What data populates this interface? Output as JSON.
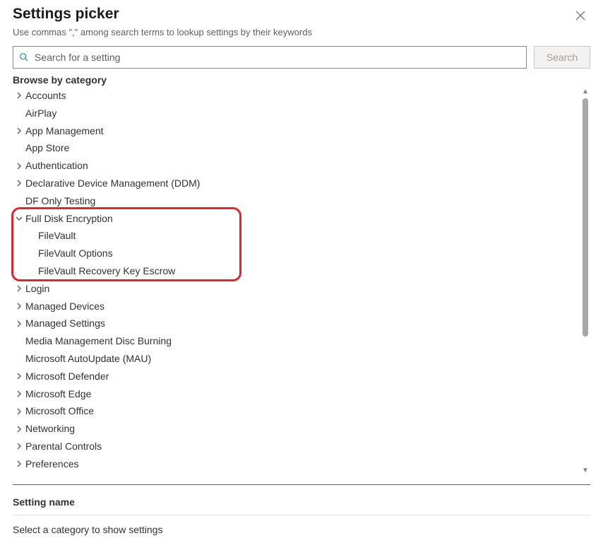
{
  "header": {
    "title": "Settings picker",
    "subtitle": "Use commas \",\" among search terms to lookup settings by their keywords"
  },
  "search": {
    "placeholder": "Search for a setting",
    "button_label": "Search"
  },
  "browse_label": "Browse by category",
  "categories": [
    {
      "label": "Accounts",
      "expandable": true,
      "expanded": false
    },
    {
      "label": "AirPlay",
      "expandable": false
    },
    {
      "label": "App Management",
      "expandable": true,
      "expanded": false
    },
    {
      "label": "App Store",
      "expandable": false
    },
    {
      "label": "Authentication",
      "expandable": true,
      "expanded": false
    },
    {
      "label": "Declarative Device Management (DDM)",
      "expandable": true,
      "expanded": false
    },
    {
      "label": "DF Only Testing",
      "expandable": false
    },
    {
      "label": "Full Disk Encryption",
      "expandable": true,
      "expanded": true,
      "highlighted": true,
      "children": [
        {
          "label": "FileVault"
        },
        {
          "label": "FileVault Options"
        },
        {
          "label": "FileVault Recovery Key Escrow"
        }
      ]
    },
    {
      "label": "Login",
      "expandable": true,
      "expanded": false
    },
    {
      "label": "Managed Devices",
      "expandable": true,
      "expanded": false
    },
    {
      "label": "Managed Settings",
      "expandable": true,
      "expanded": false
    },
    {
      "label": "Media Management Disc Burning",
      "expandable": false
    },
    {
      "label": "Microsoft AutoUpdate (MAU)",
      "expandable": false
    },
    {
      "label": "Microsoft Defender",
      "expandable": true,
      "expanded": false
    },
    {
      "label": "Microsoft Edge",
      "expandable": true,
      "expanded": false
    },
    {
      "label": "Microsoft Office",
      "expandable": true,
      "expanded": false
    },
    {
      "label": "Networking",
      "expandable": true,
      "expanded": false
    },
    {
      "label": "Parental Controls",
      "expandable": true,
      "expanded": false
    },
    {
      "label": "Preferences",
      "expandable": true,
      "expanded": false
    }
  ],
  "setting_section": {
    "heading": "Setting name",
    "placeholder": "Select a category to show settings"
  }
}
